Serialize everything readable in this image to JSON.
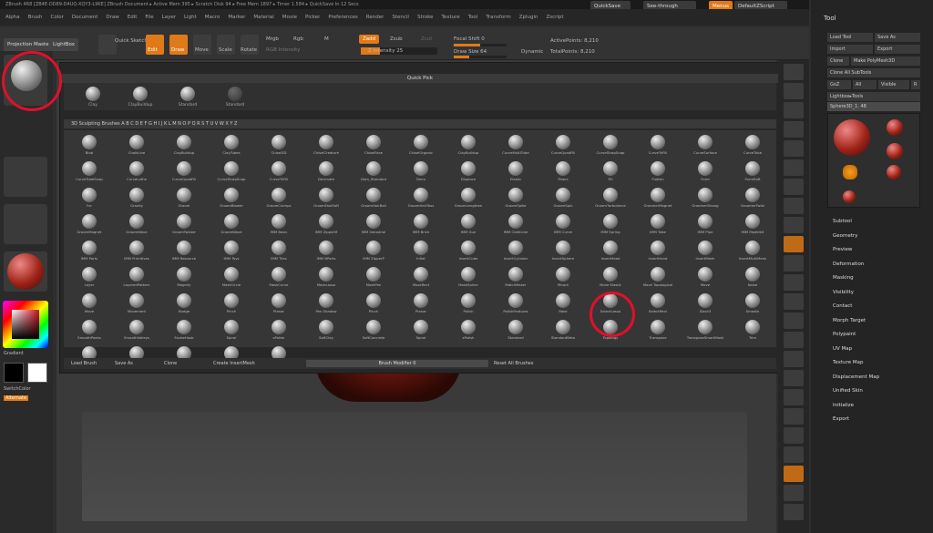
{
  "title_bar": {
    "text": "ZBrush 4R8 [ZB4E-DD89-D4UQ-XQY3-L9KE]   ZBrush Document   ▸ Active Mem 395 ▸ Scratch Disk 94 ▸ Free Mem 1897 ▸ Timer 1.584 ▸ QuickSave In 12 Secs"
  },
  "menu": {
    "items": [
      "Alpha",
      "Brush",
      "Color",
      "Document",
      "Draw",
      "Edit",
      "File",
      "Layer",
      "Light",
      "Macro",
      "Marker",
      "Material",
      "Movie",
      "Picker",
      "Preferences",
      "Render",
      "Stencil",
      "Stroke",
      "Texture",
      "Tool",
      "Transform",
      "Zplugin",
      "Zscript"
    ]
  },
  "topright": {
    "quicksave": "QuickSave",
    "seethrough": "See-through",
    "menus": "Menus",
    "default_script": "DefaultZScript"
  },
  "toolbar": {
    "projection_master": "Projection Master",
    "lightbox": "LightBox",
    "quick_sketch": "Quick Sketch",
    "edit": "Edit",
    "draw": "Draw",
    "move": "Move",
    "scale": "Scale",
    "rotate": "Rotate",
    "mrgb": "Mrgb",
    "rgb": "Rgb",
    "m": "M",
    "rgb_intensity": "RGB Intensity",
    "zadd": "Zadd",
    "zsub": "Zsub",
    "zcut": "Zcut",
    "z_intensity": "Z Intensity 25",
    "focal_shift": "Focal Shift 0",
    "draw_size": "Draw Size 64",
    "dynamic": "Dynamic",
    "active_points": "ActivePoints: 8,210",
    "total_points": "TotalPoints: 8,210"
  },
  "left": {
    "gradient": "Gradient",
    "switch_color": "SwitchColor",
    "alternate": "Alternate"
  },
  "quick_pick": {
    "title": "Quick Pick",
    "items": [
      "Clay",
      "ClayBuildup",
      "Standard",
      "Standard"
    ]
  },
  "brushes_header": "3D Sculpting Brushes   A   B   C   D   E   F   G   H   I   J   K   L   M   N   O   P   Q   R   S   T   U   V   W   X   Y   Z",
  "brushes": [
    [
      "Blob",
      "ChalkLine",
      "ClayBuildup",
      "ClayTubes",
      "Chisel3D",
      "ChiselCreature",
      "ChiselFace",
      "ChiselOrganic",
      "ClayBuildup",
      "CurveMultiTube",
      "CurveQuadFill",
      "CurveStrapSnap",
      "CurveTriFill",
      "CurveSurface",
      "CurveTube"
    ],
    [
      "CurveTubeSnap",
      "CurveLathe",
      "CurveQuadFill",
      "CurveStrapSnap",
      "CurveTriFill",
      "Decimate",
      "Dam_Standard",
      "Deco",
      "Displace",
      "Elastic",
      "Fibers",
      "Fill",
      "Flatten",
      "Form",
      "FormSoft"
    ],
    [
      "Fur",
      "Gravity",
      "Groom",
      "GroomBlower",
      "GroomClumps",
      "GroomFastSoft",
      "GroomHairBall",
      "GroomHairToss",
      "GroomLengthen",
      "GroomSpike",
      "GroomSpin",
      "GroomTurbulence",
      "GroomerMagnet",
      "GroomerStrong",
      "GroomerTwist"
    ],
    [
      "GroomMagnet",
      "GroomWave",
      "GroomTwister",
      "GroomWave",
      "IMM Basic",
      "IMM ZipperM",
      "IMM Industrial",
      "IMM Brick",
      "IMM Gun",
      "IMM ClothLine",
      "IMM Curve",
      "IMM Spring",
      "IMM Tube",
      "IMM Pipe",
      "IMM Modelkit"
    ],
    [
      "IMM Parts",
      "IMM Primitives",
      "IMM Resource",
      "IMM Toys",
      "IMM Tiles",
      "IMM BParts",
      "IMM ZipperP",
      "Inflat",
      "InsertCube",
      "InsertCylinder",
      "InsertSphere",
      "InsertHead",
      "InsertHand",
      "InsertMesh",
      "InsertMultiMesh"
    ],
    [
      "Layer",
      "LayeredPattern",
      "Magnify",
      "MaskCircle",
      "MaskCurve",
      "MaskLasso",
      "MaskPen",
      "MaskRect",
      "MaskSpline",
      "MatchMaker",
      "Morph",
      "Move Elastic",
      "Move Topological",
      "Move",
      "Noise"
    ],
    [
      "Move",
      "Movement",
      "Nudge",
      "Pinch",
      "Planar",
      "Pen Shadow",
      "Pinch",
      "Planar",
      "Polish",
      "PolishFeatures",
      "Rake",
      "SelectLasso",
      "SelectRect",
      "Slash3",
      "Smooth"
    ],
    [
      "SmoothPeaks",
      "SmoothValleys",
      "SnakeHook",
      "Spiral",
      "sPolish",
      "SoftClay",
      "SoftConcrete",
      "Spiral",
      "sPolish",
      "Standard",
      "StandardBeta",
      "Topology",
      "Transpose",
      "TransposeSmartMask",
      "Trim"
    ]
  ],
  "last_row": [
    "TrimAdaptive",
    "TrimDynamic",
    "TrimCurve",
    "TrimLasso",
    "ZProject"
  ],
  "bottom_bar": {
    "load": "Load Brush",
    "save": "Save As",
    "clone": "Clone",
    "create_insert": "Create InsertMesh",
    "brush_modifier": "Brush Modifier 0",
    "reset": "Reset All Brushes"
  },
  "tool_panel": {
    "title": "Tool",
    "load_tool": "Load Tool",
    "save_as": "Save As",
    "import": "Import",
    "export": "Export",
    "clone": "Clone",
    "make_polymesh": "Make PolyMesh3D",
    "clone_all": "Clone All SubTools",
    "goz": "GoZ",
    "all": "All",
    "visible": "Visible",
    "r": "R",
    "lightbox_tools": "Lightbox▸Tools",
    "current_tool": "Sphere3D_1. 48",
    "subtools": [
      "Sphere3D",
      "Cylinder3D",
      "PolyMesh3D",
      "SimpleBrush",
      "Sphere3D_1"
    ],
    "sections": [
      "Subtool",
      "Geometry",
      "Preview",
      "Deformation",
      "Masking",
      "Visibility",
      "Contact",
      "Morph Target",
      "Polypaint",
      "UV Map",
      "Texture Map",
      "Displacement Map",
      "Unified Skin",
      "Initialize",
      "Export"
    ]
  }
}
